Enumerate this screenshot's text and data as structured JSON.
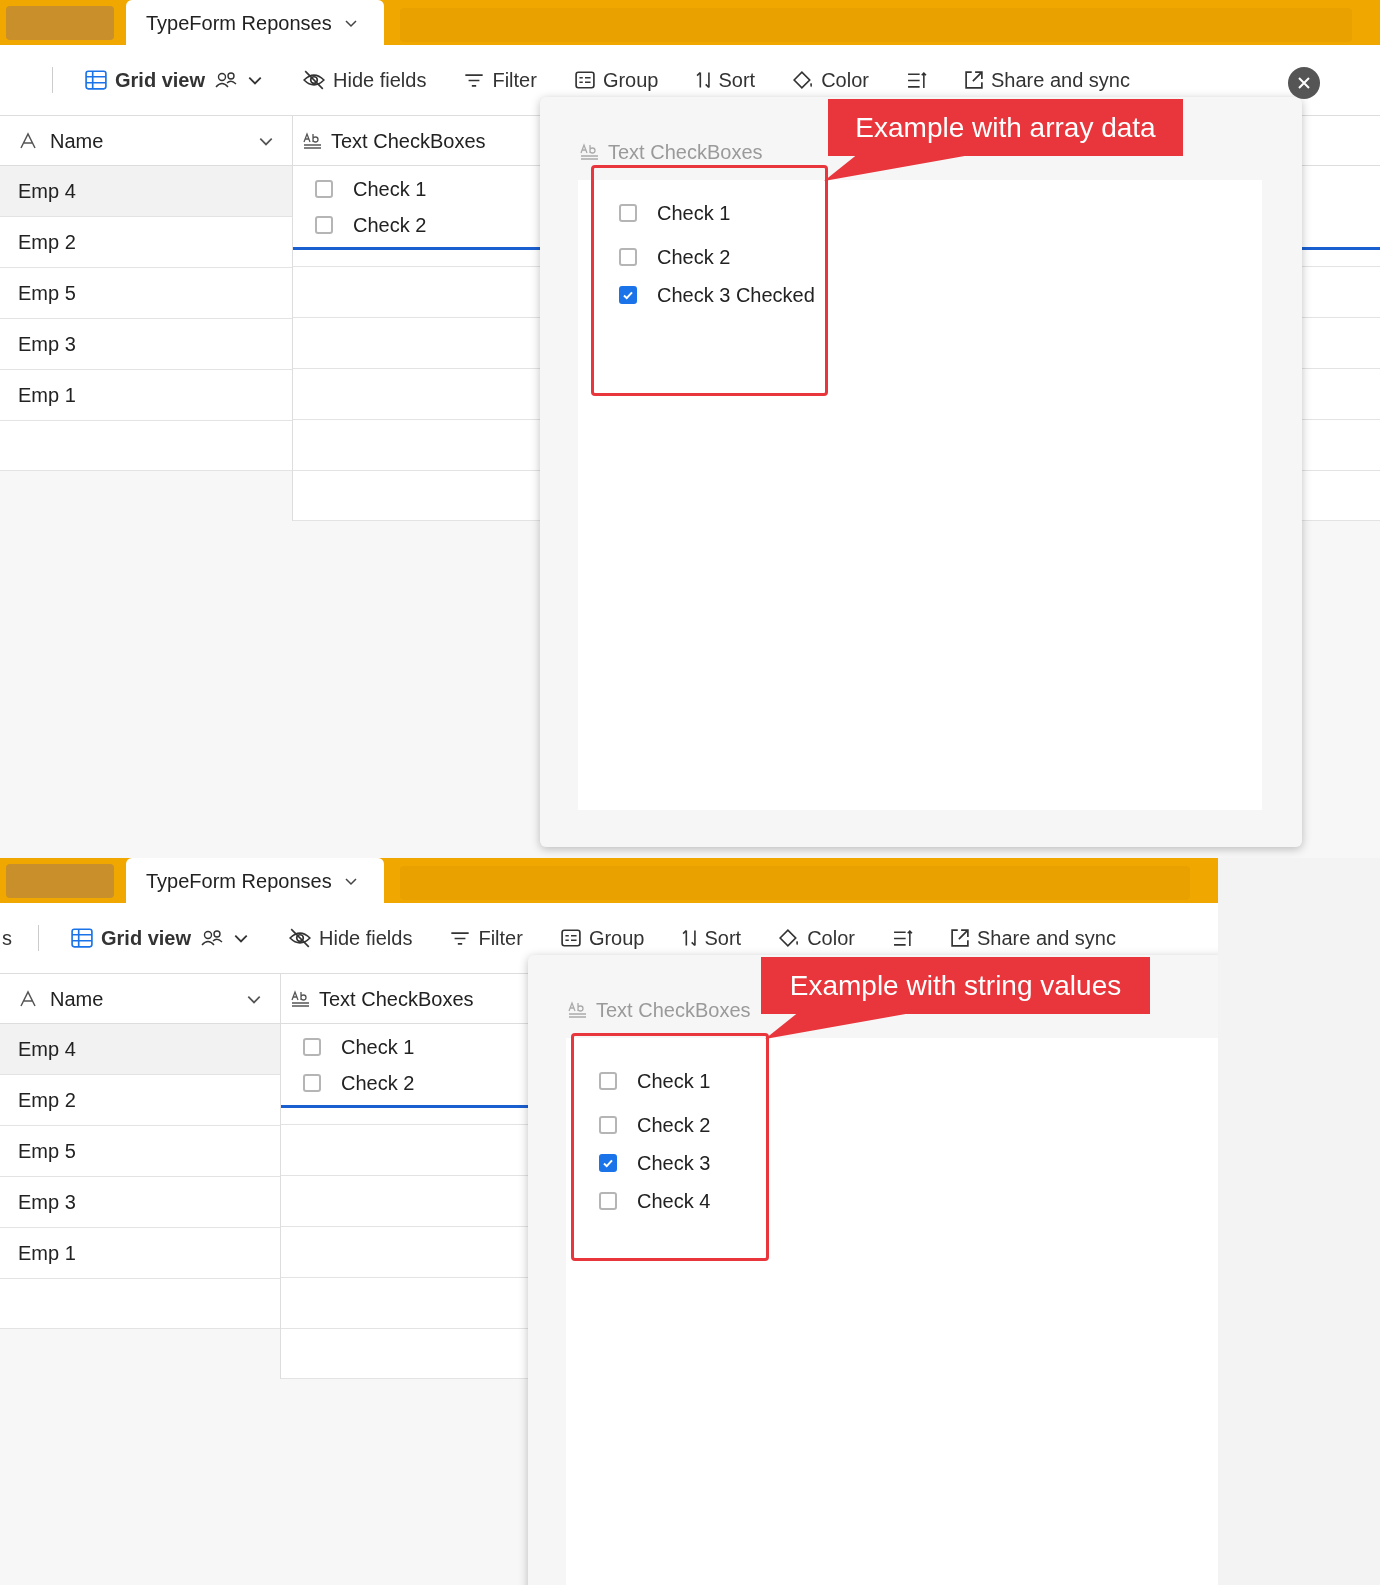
{
  "panels": [
    {
      "tab": "TypeForm Reponses",
      "toolbar": {
        "items": [
          {
            "kind": "button",
            "label": "Grid view"
          },
          {
            "kind": "button",
            "label": "Hide fields"
          },
          {
            "kind": "button",
            "label": "Filter"
          },
          {
            "kind": "button",
            "label": "Group"
          },
          {
            "kind": "button",
            "label": "Sort"
          },
          {
            "kind": "button",
            "label": "Color"
          },
          {
            "kind": "icon"
          },
          {
            "kind": "button",
            "label": "Share and sync"
          }
        ]
      },
      "columns": [
        {
          "label": "Name"
        },
        {
          "label": "Text CheckBoxes"
        }
      ],
      "rows": [
        {
          "name": "Emp 4",
          "selected": true,
          "checks": [
            "Check 1",
            "Check 2"
          ]
        },
        {
          "name": "Emp 2",
          "selected": false
        },
        {
          "name": "Emp 5",
          "selected": false
        },
        {
          "name": "Emp 3",
          "selected": false
        },
        {
          "name": "Emp 1",
          "selected": false
        }
      ],
      "popup": {
        "field_label": "Text CheckBoxes",
        "close_button": true,
        "options": [
          {
            "label": "Check 1",
            "checked": false
          },
          {
            "label": "Check 2",
            "checked": false
          },
          {
            "label": "Check 3 Checked",
            "checked": true
          }
        ]
      },
      "annotation": "Example with array data"
    },
    {
      "tab": "TypeForm Reponses",
      "toolbar": {
        "cut_item": "s",
        "items": [
          {
            "kind": "button",
            "label": "Grid view"
          },
          {
            "kind": "button",
            "label": "Hide fields"
          },
          {
            "kind": "button",
            "label": "Filter"
          },
          {
            "kind": "button",
            "label": "Group"
          },
          {
            "kind": "button",
            "label": "Sort"
          },
          {
            "kind": "button",
            "label": "Color"
          },
          {
            "kind": "icon"
          },
          {
            "kind": "button",
            "label": "Share and sync"
          }
        ]
      },
      "columns": [
        {
          "label": "Name"
        },
        {
          "label": "Text CheckBoxes"
        }
      ],
      "rows": [
        {
          "name": "Emp 4",
          "selected": true,
          "checks": [
            "Check 1",
            "Check 2"
          ]
        },
        {
          "name": "Emp 2",
          "selected": false
        },
        {
          "name": "Emp 5",
          "selected": false
        },
        {
          "name": "Emp 3",
          "selected": false
        },
        {
          "name": "Emp 1",
          "selected": false
        }
      ],
      "popup": {
        "field_label": "Text CheckBoxes",
        "close_button": false,
        "options": [
          {
            "label": "Check 1",
            "checked": false
          },
          {
            "label": "Check 2",
            "checked": false
          },
          {
            "label": "Check 3",
            "checked": true
          },
          {
            "label": "Check 4",
            "checked": false
          }
        ]
      },
      "annotation": "Example with string values"
    }
  ]
}
